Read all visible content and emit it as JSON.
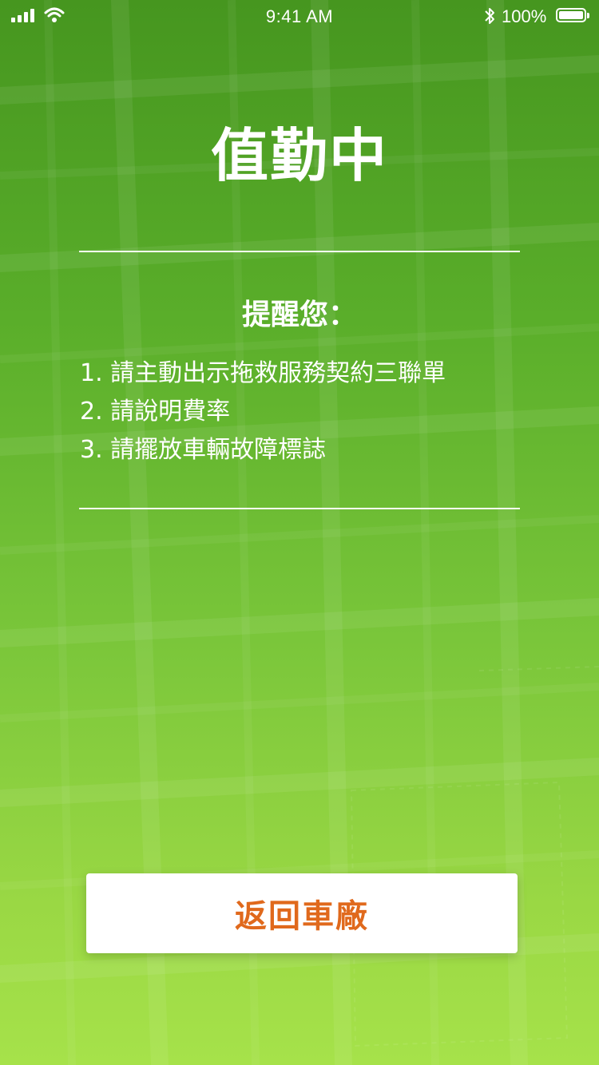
{
  "status_bar": {
    "time": "9:41 AM",
    "battery_percent": "100%",
    "battery_level": 1.0,
    "icons": [
      "signal-icon",
      "wifi-icon",
      "bluetooth-icon",
      "battery-icon"
    ]
  },
  "screen": {
    "title": "值勤中",
    "reminder_heading": "提醒您：",
    "reminders": [
      "1. 請主動出示拖救服務契約三聯單",
      "2. 請說明費率",
      "3. 請擺放車輛故障標誌"
    ]
  },
  "actions": {
    "return_label": "返回車廠"
  },
  "colors": {
    "background_top": "#46961f",
    "background_bottom": "#a6e24a",
    "button_text": "#e0691c",
    "button_background": "#ffffff",
    "text": "#ffffff"
  }
}
